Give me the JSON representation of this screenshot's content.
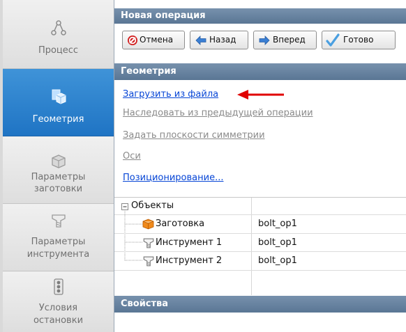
{
  "nav": {
    "items": [
      {
        "label": "Процесс",
        "icon": "process-flow-icon",
        "active": false
      },
      {
        "label": "Геометрия",
        "icon": "geometry-cube-icon",
        "active": true
      },
      {
        "label": "Параметры заготовки",
        "icon": "workpiece-icon",
        "active": false
      },
      {
        "label": "Параметры инструмента",
        "icon": "tool-icon",
        "active": false
      },
      {
        "label": "Условия остановки",
        "icon": "traffic-light-icon",
        "active": false
      }
    ]
  },
  "header": {
    "title": "Новая операция"
  },
  "toolbar": {
    "cancel_label": "Отмена",
    "back_label": "Назад",
    "forward_label": "Вперед",
    "done_label": "Готово"
  },
  "geometry": {
    "title": "Геометрия",
    "links": [
      {
        "label": "Загрузить из файла",
        "enabled": true
      },
      {
        "label": "Наследовать из предыдущей операции",
        "enabled": false
      },
      {
        "label": "Задать плоскости симметрии",
        "enabled": false
      },
      {
        "label": "Оси",
        "enabled": false
      },
      {
        "label": "Позиционирование...",
        "enabled": true
      }
    ]
  },
  "tree": {
    "root": "Объекты",
    "rows": [
      {
        "name": "Заготовка",
        "value": "bolt_op1",
        "icon": "workpiece-icon"
      },
      {
        "name": "Инструмент 1",
        "value": "bolt_op1",
        "icon": "tool-icon"
      },
      {
        "name": "Инструмент 2",
        "value": "bolt_op1",
        "icon": "tool-icon"
      }
    ]
  },
  "properties": {
    "title": "Свойства"
  },
  "colors": {
    "accent": "#2a7fd0",
    "header": "#6a84a2",
    "link": "#0645d6",
    "annotation_arrow": "#e00000"
  }
}
